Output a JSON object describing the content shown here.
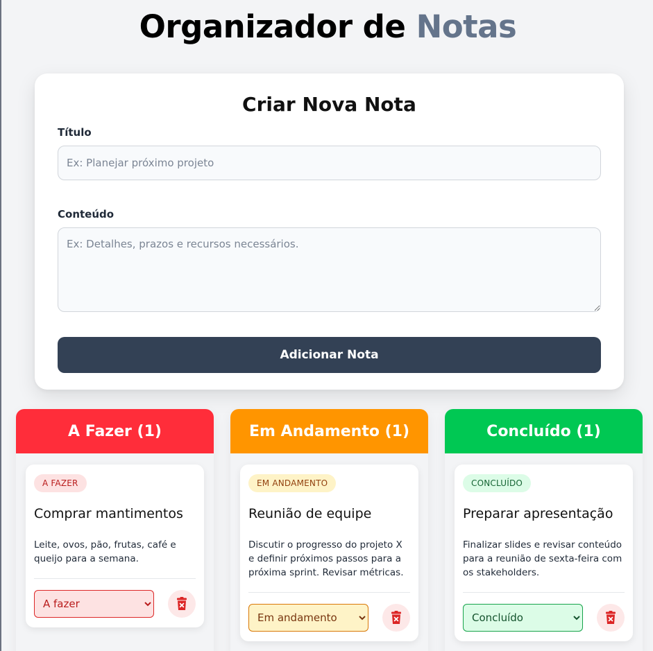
{
  "header": {
    "title_main": "Organizador de ",
    "title_accent": "Notas"
  },
  "form": {
    "title": "Criar Nova Nota",
    "title_label": "Título",
    "title_placeholder": "Ex: Planejar próximo projeto",
    "content_label": "Conteúdo",
    "content_placeholder": "Ex: Detalhes, prazos e recursos necessários.",
    "submit_label": "Adicionar Nota"
  },
  "columns": [
    {
      "heading": "A Fazer (1)",
      "color": "#ff2d3a",
      "note": {
        "badge": "A FAZER",
        "title": "Comprar mantimentos",
        "body": "Leite, ovos, pão, frutas, café e queijo para a semana.",
        "status": "A fazer"
      }
    },
    {
      "heading": "Em Andamento (1)",
      "color": "#ff9500",
      "note": {
        "badge": "EM ANDAMENTO",
        "title": "Reunião de equipe",
        "body": "Discutir o progresso do projeto X e definir próximos passos para a próxima sprint. Revisar métricas.",
        "status": "Em andamento"
      }
    },
    {
      "heading": "Concluído (1)",
      "color": "#00c853",
      "note": {
        "badge": "CONCLUÍDO",
        "title": "Preparar apresentação",
        "body": "Finalizar slides e revisar conteúdo para a reunião de sexta-feira com os stakeholders.",
        "status": "Concluído"
      }
    }
  ],
  "icons": {
    "delete": "trash-icon"
  }
}
